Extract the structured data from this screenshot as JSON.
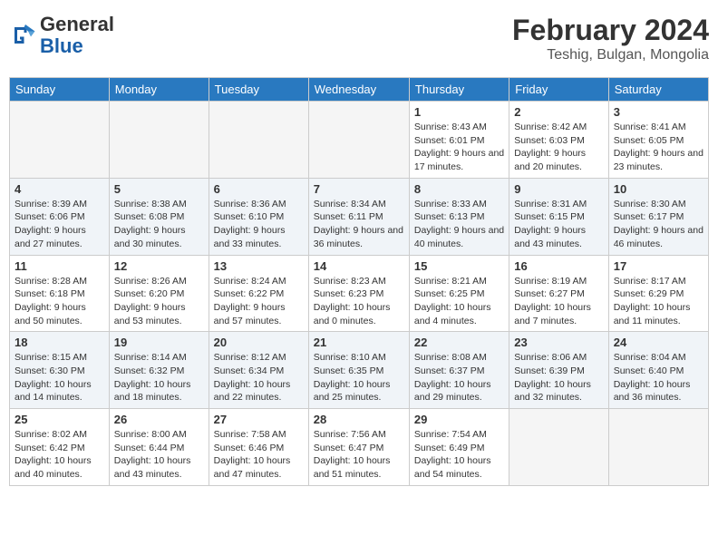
{
  "header": {
    "logo_general": "General",
    "logo_blue": "Blue",
    "month_year": "February 2024",
    "location": "Teshig, Bulgan, Mongolia"
  },
  "weekdays": [
    "Sunday",
    "Monday",
    "Tuesday",
    "Wednesday",
    "Thursday",
    "Friday",
    "Saturday"
  ],
  "weeks": [
    [
      {
        "day": "",
        "info": ""
      },
      {
        "day": "",
        "info": ""
      },
      {
        "day": "",
        "info": ""
      },
      {
        "day": "",
        "info": ""
      },
      {
        "day": "1",
        "info": "Sunrise: 8:43 AM\nSunset: 6:01 PM\nDaylight: 9 hours and 17 minutes."
      },
      {
        "day": "2",
        "info": "Sunrise: 8:42 AM\nSunset: 6:03 PM\nDaylight: 9 hours and 20 minutes."
      },
      {
        "day": "3",
        "info": "Sunrise: 8:41 AM\nSunset: 6:05 PM\nDaylight: 9 hours and 23 minutes."
      }
    ],
    [
      {
        "day": "4",
        "info": "Sunrise: 8:39 AM\nSunset: 6:06 PM\nDaylight: 9 hours and 27 minutes."
      },
      {
        "day": "5",
        "info": "Sunrise: 8:38 AM\nSunset: 6:08 PM\nDaylight: 9 hours and 30 minutes."
      },
      {
        "day": "6",
        "info": "Sunrise: 8:36 AM\nSunset: 6:10 PM\nDaylight: 9 hours and 33 minutes."
      },
      {
        "day": "7",
        "info": "Sunrise: 8:34 AM\nSunset: 6:11 PM\nDaylight: 9 hours and 36 minutes."
      },
      {
        "day": "8",
        "info": "Sunrise: 8:33 AM\nSunset: 6:13 PM\nDaylight: 9 hours and 40 minutes."
      },
      {
        "day": "9",
        "info": "Sunrise: 8:31 AM\nSunset: 6:15 PM\nDaylight: 9 hours and 43 minutes."
      },
      {
        "day": "10",
        "info": "Sunrise: 8:30 AM\nSunset: 6:17 PM\nDaylight: 9 hours and 46 minutes."
      }
    ],
    [
      {
        "day": "11",
        "info": "Sunrise: 8:28 AM\nSunset: 6:18 PM\nDaylight: 9 hours and 50 minutes."
      },
      {
        "day": "12",
        "info": "Sunrise: 8:26 AM\nSunset: 6:20 PM\nDaylight: 9 hours and 53 minutes."
      },
      {
        "day": "13",
        "info": "Sunrise: 8:24 AM\nSunset: 6:22 PM\nDaylight: 9 hours and 57 minutes."
      },
      {
        "day": "14",
        "info": "Sunrise: 8:23 AM\nSunset: 6:23 PM\nDaylight: 10 hours and 0 minutes."
      },
      {
        "day": "15",
        "info": "Sunrise: 8:21 AM\nSunset: 6:25 PM\nDaylight: 10 hours and 4 minutes."
      },
      {
        "day": "16",
        "info": "Sunrise: 8:19 AM\nSunset: 6:27 PM\nDaylight: 10 hours and 7 minutes."
      },
      {
        "day": "17",
        "info": "Sunrise: 8:17 AM\nSunset: 6:29 PM\nDaylight: 10 hours and 11 minutes."
      }
    ],
    [
      {
        "day": "18",
        "info": "Sunrise: 8:15 AM\nSunset: 6:30 PM\nDaylight: 10 hours and 14 minutes."
      },
      {
        "day": "19",
        "info": "Sunrise: 8:14 AM\nSunset: 6:32 PM\nDaylight: 10 hours and 18 minutes."
      },
      {
        "day": "20",
        "info": "Sunrise: 8:12 AM\nSunset: 6:34 PM\nDaylight: 10 hours and 22 minutes."
      },
      {
        "day": "21",
        "info": "Sunrise: 8:10 AM\nSunset: 6:35 PM\nDaylight: 10 hours and 25 minutes."
      },
      {
        "day": "22",
        "info": "Sunrise: 8:08 AM\nSunset: 6:37 PM\nDaylight: 10 hours and 29 minutes."
      },
      {
        "day": "23",
        "info": "Sunrise: 8:06 AM\nSunset: 6:39 PM\nDaylight: 10 hours and 32 minutes."
      },
      {
        "day": "24",
        "info": "Sunrise: 8:04 AM\nSunset: 6:40 PM\nDaylight: 10 hours and 36 minutes."
      }
    ],
    [
      {
        "day": "25",
        "info": "Sunrise: 8:02 AM\nSunset: 6:42 PM\nDaylight: 10 hours and 40 minutes."
      },
      {
        "day": "26",
        "info": "Sunrise: 8:00 AM\nSunset: 6:44 PM\nDaylight: 10 hours and 43 minutes."
      },
      {
        "day": "27",
        "info": "Sunrise: 7:58 AM\nSunset: 6:46 PM\nDaylight: 10 hours and 47 minutes."
      },
      {
        "day": "28",
        "info": "Sunrise: 7:56 AM\nSunset: 6:47 PM\nDaylight: 10 hours and 51 minutes."
      },
      {
        "day": "29",
        "info": "Sunrise: 7:54 AM\nSunset: 6:49 PM\nDaylight: 10 hours and 54 minutes."
      },
      {
        "day": "",
        "info": ""
      },
      {
        "day": "",
        "info": ""
      }
    ]
  ]
}
